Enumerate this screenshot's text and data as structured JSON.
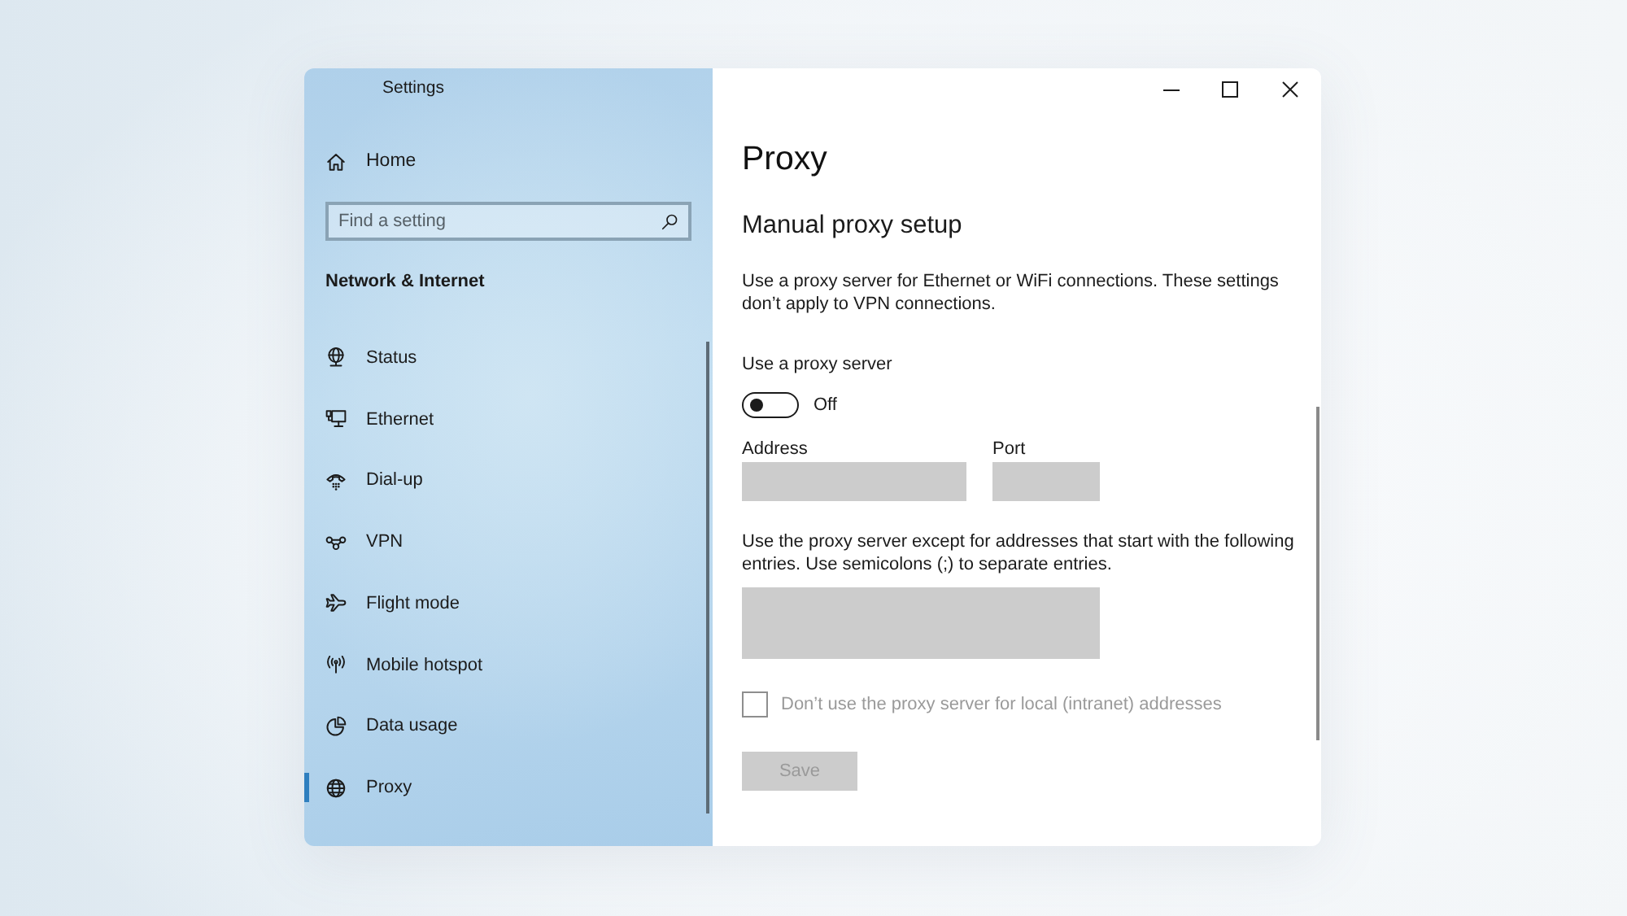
{
  "window": {
    "title": "Settings"
  },
  "sidebar": {
    "home": "Home",
    "search": {
      "placeholder": "Find a setting"
    },
    "section": "Network & Internet",
    "items": [
      {
        "label": "Status",
        "selected": false
      },
      {
        "label": "Ethernet",
        "selected": false
      },
      {
        "label": "Dial-up",
        "selected": false
      },
      {
        "label": "VPN",
        "selected": false
      },
      {
        "label": "Flight mode",
        "selected": false
      },
      {
        "label": "Mobile hotspot",
        "selected": false
      },
      {
        "label": "Data usage",
        "selected": false
      },
      {
        "label": "Proxy",
        "selected": true
      }
    ]
  },
  "content": {
    "title": "Proxy",
    "section": "Manual proxy setup",
    "description": "Use a proxy server for Ethernet or WiFi connections. These settings don’t apply to VPN connections.",
    "proxy_toggle": {
      "label": "Use a proxy server",
      "on": false,
      "state_text": "Off"
    },
    "address_field": {
      "label": "Address",
      "disabled": true
    },
    "port_field": {
      "label": "Port",
      "disabled": true
    },
    "exceptions": {
      "description": "Use the proxy server except for addresses that start with the following entries. Use semicolons (;) to separate entries.",
      "disabled": true
    },
    "local_checkbox": {
      "label": "Don’t use the proxy server for local (intranet) addresses",
      "checked": false,
      "disabled": true
    },
    "save_button": {
      "label": "Save",
      "disabled": true
    }
  }
}
